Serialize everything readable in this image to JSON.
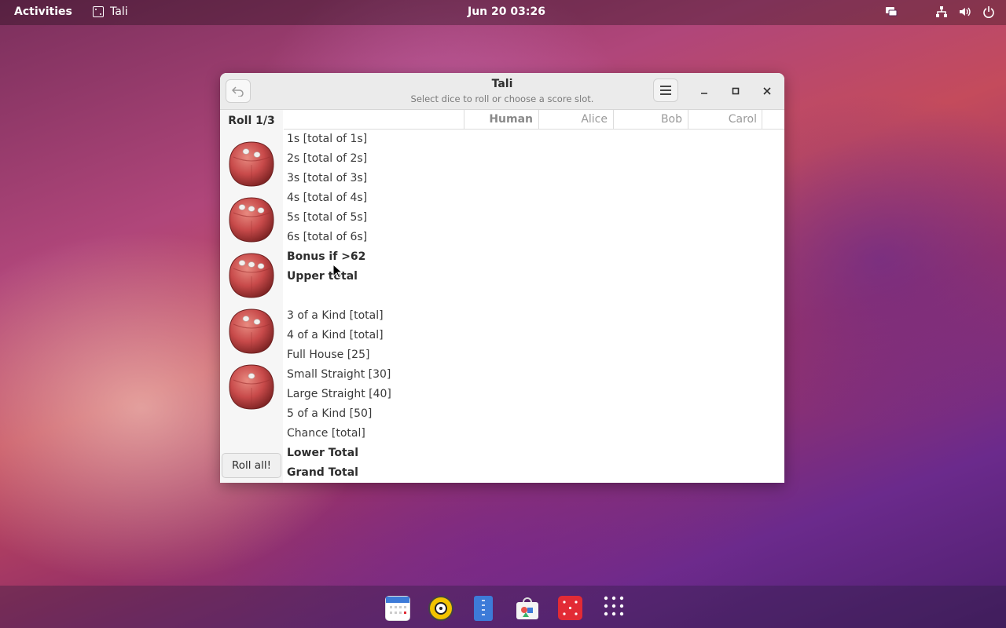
{
  "topbar": {
    "activities": "Activities",
    "app_name": "Tali",
    "clock": "Jun 20  03:26"
  },
  "window": {
    "title": "Tali",
    "subtitle": "Select dice to roll or choose a score slot.",
    "roll_count": "Roll 1/3",
    "roll_button": "Roll all!",
    "dice_values": [
      2,
      3,
      3,
      2,
      1
    ],
    "players": [
      "Human",
      "Alice",
      "Bob",
      "Carol"
    ],
    "rows": [
      {
        "label": "1s [total of 1s]",
        "bold": false
      },
      {
        "label": "2s [total of 2s]",
        "bold": false
      },
      {
        "label": "3s [total of 3s]",
        "bold": false
      },
      {
        "label": "4s [total of 4s]",
        "bold": false
      },
      {
        "label": "5s [total of 5s]",
        "bold": false
      },
      {
        "label": "6s [total of 6s]",
        "bold": false
      },
      {
        "label": "Bonus if >62",
        "bold": true
      },
      {
        "label": "Upper total",
        "bold": true
      },
      {
        "label": "",
        "bold": false
      },
      {
        "label": "3 of a Kind [total]",
        "bold": false
      },
      {
        "label": "4 of a Kind [total]",
        "bold": false
      },
      {
        "label": "Full House [25]",
        "bold": false
      },
      {
        "label": "Small Straight [30]",
        "bold": false
      },
      {
        "label": "Large Straight [40]",
        "bold": false
      },
      {
        "label": "5 of a Kind [50]",
        "bold": false
      },
      {
        "label": "Chance [total]",
        "bold": false
      },
      {
        "label": "Lower Total",
        "bold": true
      },
      {
        "label": "Grand Total",
        "bold": true
      }
    ]
  },
  "dock": {
    "items": [
      "calendar-icon",
      "rhythmbox-icon",
      "text-editor-icon",
      "software-center-icon",
      "tali-icon",
      "app-grid-icon"
    ]
  },
  "colors": {
    "die_red": "#c84a4a",
    "tali_red": "#e22b35"
  }
}
